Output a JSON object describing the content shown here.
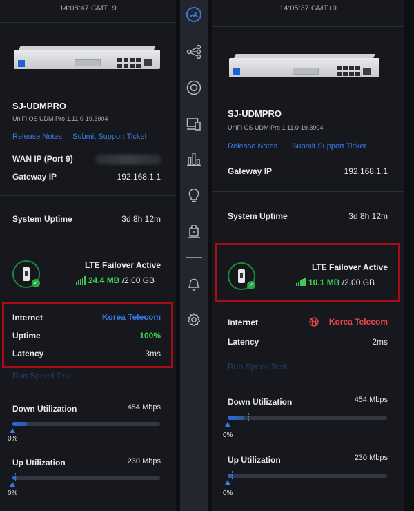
{
  "colors": {
    "accent": "#3a7be6",
    "green": "#3fd44f",
    "red_alert": "#e5484d",
    "highlight_box": "#a80d14"
  },
  "left": {
    "timestamp": "14:08:47 GMT+9",
    "device_name": "SJ-UDMPRO",
    "firmware": "UniFi OS UDM Pro 1.11.0-19.3904",
    "release_notes": "Release Notes",
    "support_ticket": "Submit Support Ticket",
    "wan_ip_label": "WAN IP (Port 9)",
    "gateway_ip_label": "Gateway IP",
    "gateway_ip": "192.168.1.1",
    "uptime_label": "System Uptime",
    "uptime": "3d 8h 12m",
    "lte_status": "LTE Failover Active",
    "lte_used": "24.4 MB",
    "lte_total": "/2.00 GB",
    "internet_label": "Internet",
    "isp": "Korea Telecom",
    "isp_uptime_label": "Uptime",
    "isp_uptime": "100%",
    "latency_label": "Latency",
    "latency": "3ms",
    "speed_test": "Run Speed Test",
    "down_label": "Down Utilization",
    "down_capacity": "454 Mbps",
    "down_pct": "0%",
    "down_level": 0.0,
    "up_label": "Up Utilization",
    "up_capacity": "230 Mbps",
    "up_pct": "0%",
    "up_level": 0.0
  },
  "right": {
    "timestamp": "14:05:37 GMT+9",
    "device_name": "SJ-UDMPRO",
    "firmware": "UniFi OS UDM Pro 1.11.0-19.3904",
    "release_notes": "Release Notes",
    "support_ticket": "Submit Support Ticket",
    "gateway_ip_label": "Gateway IP",
    "gateway_ip": "192.168.1.1",
    "uptime_label": "System Uptime",
    "uptime": "3d 8h 12m",
    "lte_status": "LTE Failover Active",
    "lte_used": "10.1 MB",
    "lte_total": "/2.00 GB",
    "internet_label": "Internet",
    "isp": "Korea Telecom",
    "latency_label": "Latency",
    "latency": "2ms",
    "speed_test": "Run Speed Test",
    "down_label": "Down Utilization",
    "down_capacity": "454 Mbps",
    "down_pct": "0%",
    "down_level": 0.0,
    "up_label": "Up Utilization",
    "up_capacity": "230 Mbps",
    "up_pct": "0%",
    "up_level": 0.0
  },
  "sidebar": {
    "icons": [
      "dashboard-icon",
      "topology-icon",
      "devices-icon",
      "clients-icon",
      "statistics-icon",
      "insights-icon",
      "alarm-manager-icon",
      "notifications-icon",
      "settings-icon"
    ]
  }
}
